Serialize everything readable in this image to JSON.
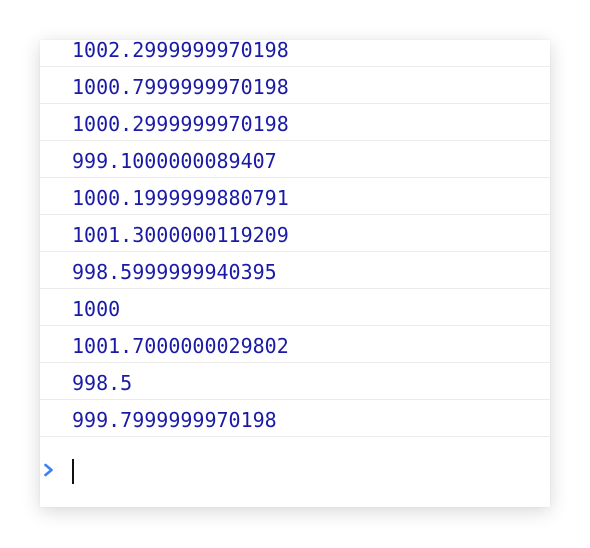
{
  "console": {
    "log_entries": [
      "1002.2999999970198",
      "1000.7999999970198",
      "1000.2999999970198",
      "999.1000000089407",
      "1000.1999999880791",
      "1001.3000000119209",
      "998.5999999940395",
      "1000",
      "1001.7000000029802",
      "998.5",
      "999.7999999970198"
    ],
    "prompt": {
      "icon": "chevron-right-icon",
      "value": ""
    }
  },
  "colors": {
    "number_text": "#1a1aa6",
    "prompt_accent": "#3b82f6",
    "row_divider": "#ebebeb"
  }
}
